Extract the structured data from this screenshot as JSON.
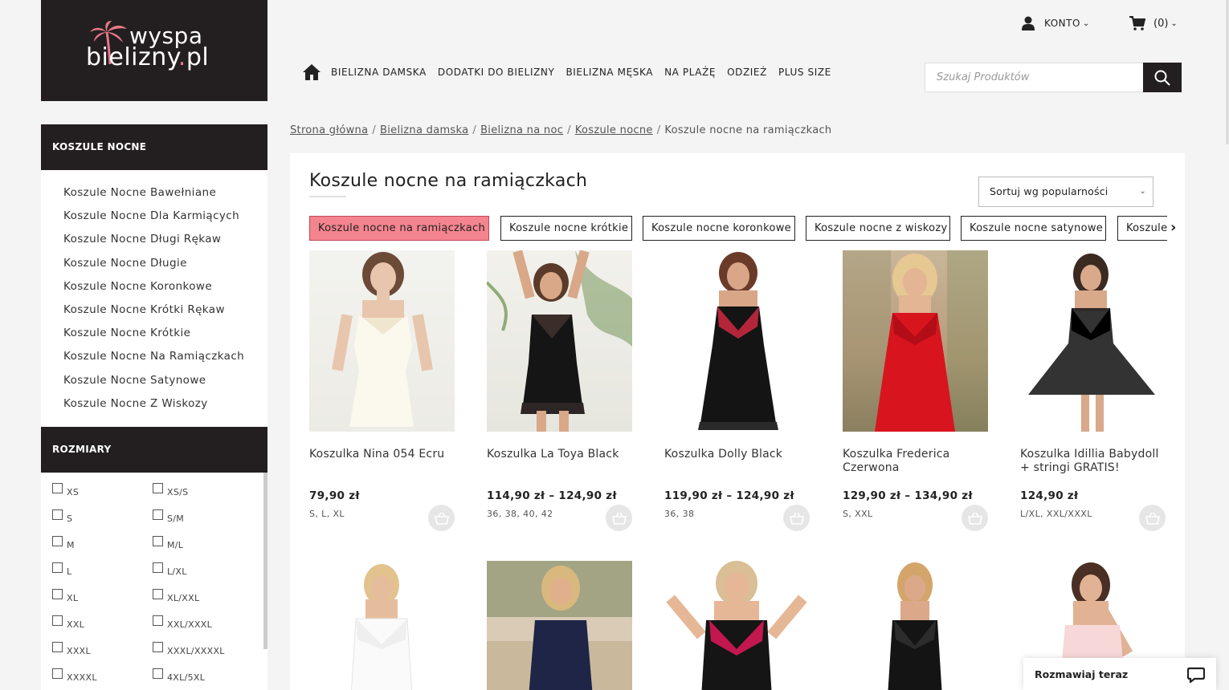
{
  "logo": {
    "line1": "wyspa",
    "line2_a": "bieliz",
    "line2_b": "ny",
    "line2_dot": ".",
    "line2_c": "pl",
    "alt": "wyspa bielizny.pl"
  },
  "nav": {
    "items": [
      "BIELIZNA DAMSKA",
      "DODATKI DO BIELIZNY",
      "BIELIZNA MĘSKA",
      "NA PLAŻĘ",
      "ODZIEŻ",
      "PLUS SIZE"
    ]
  },
  "account": {
    "label": "KONTO"
  },
  "cart": {
    "count": "(0)"
  },
  "search": {
    "placeholder": "Szukaj Produktów"
  },
  "sidebar": {
    "categories_title": "KOSZULE NOCNE",
    "categories": [
      "Koszule Nocne Bawełniane",
      "Koszule Nocne Dla Karmiących",
      "Koszule Nocne Długi Rękaw",
      "Koszule Nocne Długie",
      "Koszule Nocne Koronkowe",
      "Koszule Nocne Krótki Rękaw",
      "Koszule Nocne Krótkie",
      "Koszule Nocne Na Ramiączkach",
      "Koszule Nocne Satynowe",
      "Koszule Nocne Z Wiskozy"
    ],
    "sizes_title": "ROZMIARY",
    "sizes": [
      "XS",
      "XS/S",
      "S",
      "S/M",
      "M",
      "M/L",
      "L",
      "L/XL",
      "XL",
      "XL/XXL",
      "XXL",
      "XXL/XXXL",
      "XXXL",
      "XXXL/XXXXL",
      "XXXXL",
      "4XL/5XL"
    ]
  },
  "breadcrumb": {
    "links": [
      "Strona główna",
      "Bielizna damska",
      "Bielizna na noc",
      "Koszule nocne"
    ],
    "current": "Koszule nocne na ramiączkach",
    "separator": "/"
  },
  "main": {
    "title": "Koszule nocne na ramiączkach",
    "sort": "Sortuj wg popularności",
    "chips": [
      "Koszule nocne na ramiączkach",
      "Koszule nocne krótkie",
      "Koszule nocne koronkowe",
      "Koszule nocne z wiskozy",
      "Koszule nocne satynowe",
      "Koszule"
    ],
    "active_chip_color": "#f4848e"
  },
  "products": [
    {
      "name": "Koszulka Nina 054 Ecru",
      "price": "79,90 zł",
      "sizes": "S, L, XL"
    },
    {
      "name": "Koszulka La Toya Black",
      "price": "114,90 zł – 124,90 zł",
      "sizes": "36, 38, 40, 42"
    },
    {
      "name": "Koszulka Dolly Black",
      "price": "119,90 zł – 124,90 zł",
      "sizes": "36, 38"
    },
    {
      "name": "Koszulka Frederica Czerwona",
      "price": "129,90 zł – 134,90 zł",
      "sizes": "S, XXL"
    },
    {
      "name": "Koszulka Idillia Babydoll + stringi GRATIS!",
      "price": "124,90 zł",
      "sizes": "L/XL, XXL/XXXL"
    }
  ],
  "chat": {
    "label": "Rozmawiaj teraz"
  },
  "colors": {
    "dark": "#231f20",
    "pink": "#f4848e",
    "bg": "#f4f4f4"
  }
}
